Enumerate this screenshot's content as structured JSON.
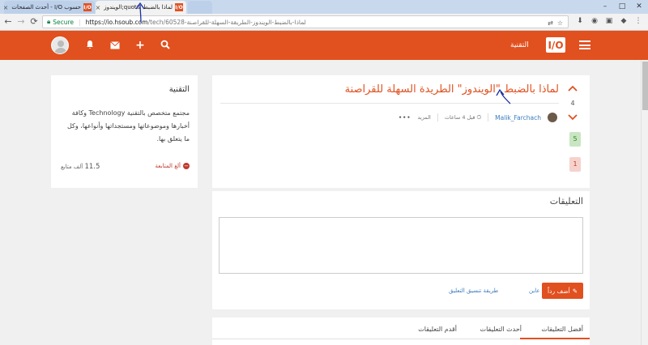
{
  "browser": {
    "tabs": [
      {
        "title": "حسوب I/O - أحدث الصفحات",
        "favicon": "I/O"
      },
      {
        "title": "لماذا بالضبط &quot;الويندوز",
        "favicon": "I/O"
      }
    ],
    "secure_label": "Secure",
    "url_host": "https://io.hsoub.com",
    "url_path": "/tech/60528-لماذا-بالضبط-الويندوز-الطريقة-السهلة-للقراصنة"
  },
  "header": {
    "site_name": "التقنية",
    "logo_text": "I/O",
    "brand_color": "#e1501f"
  },
  "sidebar": {
    "title": "التقنية",
    "description": "مجتمع متخصص بالتقنية Technology وكافة أخبارها وموضوعاتها ومستجداتها وأنواعها، وكل ما يتعلق بها.",
    "unfollow_label": "ألغ المتابعة",
    "followers_count": "11.5",
    "followers_label": "ألف متابع"
  },
  "post": {
    "title": "لماذا بالضبط \"الويندوز\" الطريدة السهلة للقراصنة",
    "votes": "4",
    "upvotes": "5",
    "downvotes": "1",
    "author": "Malik_Farchach",
    "time_ago": "قبل 4 ساعات",
    "more_label": "المزيد"
  },
  "comments": {
    "title": "التعليقات",
    "add_reply_label": "أضف رداً",
    "preview_label": "عاين",
    "format_label": "طريقة تنسيق التعليق"
  },
  "sort_tabs": [
    {
      "label": "أفضل التعليقات"
    },
    {
      "label": "أحدث التعليقات"
    },
    {
      "label": "أقدم التعليقات"
    }
  ]
}
